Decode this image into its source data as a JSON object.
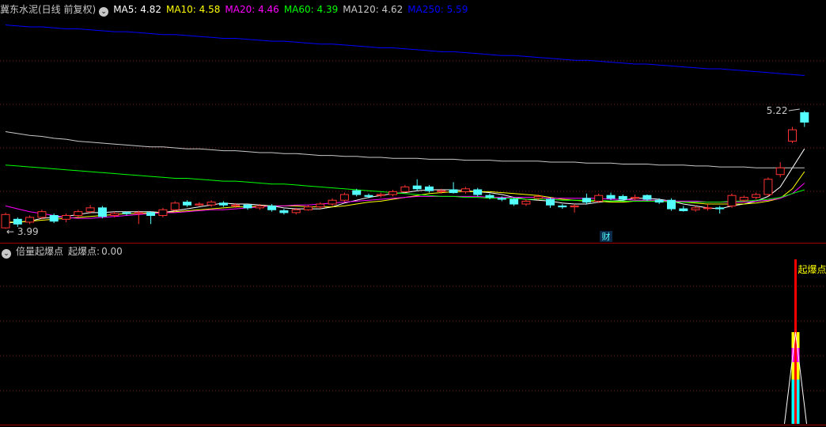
{
  "top_legend": {
    "title": "冀东水泥(日线 前复权)",
    "items": [
      {
        "name": "MA5",
        "value": "4.82",
        "color": "#ffffff"
      },
      {
        "name": "MA10",
        "value": "4.58",
        "color": "#ffff00"
      },
      {
        "name": "MA20",
        "value": "4.46",
        "color": "#ff00ff"
      },
      {
        "name": "MA60",
        "value": "4.39",
        "color": "#00ff00"
      },
      {
        "name": "MA120",
        "value": "4.62",
        "color": "#c8c8c8"
      },
      {
        "name": "MA250",
        "value": "5.59",
        "color": "#0000ff"
      }
    ]
  },
  "bottom_legend": {
    "title": "倍量起爆点",
    "item_label": "起爆点",
    "item_value": "0.00"
  },
  "chart_data": [
    {
      "type": "candlestick",
      "title": "冀东水泥(日线 前复权)",
      "ylim": [
        3.85,
        6.2
      ],
      "annotations": {
        "high_label": "5.22",
        "low_label": "3.99",
        "event_marker": "财"
      },
      "candles": [
        [
          3.99,
          4.13,
          4.15,
          3.98
        ],
        [
          4.08,
          4.03,
          4.1,
          4.0
        ],
        [
          4.05,
          4.1,
          4.12,
          4.03
        ],
        [
          4.1,
          4.16,
          4.18,
          4.08
        ],
        [
          4.12,
          4.06,
          4.14,
          4.04
        ],
        [
          4.08,
          4.12,
          4.14,
          4.05
        ],
        [
          4.12,
          4.16,
          4.18,
          4.1
        ],
        [
          4.16,
          4.2,
          4.23,
          4.14
        ],
        [
          4.2,
          4.11,
          4.22,
          4.09
        ],
        [
          4.12,
          4.14,
          4.16,
          4.1
        ],
        [
          4.15,
          4.14,
          4.16,
          4.12
        ],
        [
          4.14,
          4.15,
          4.17,
          4.03
        ],
        [
          4.15,
          4.12,
          4.16,
          4.03
        ],
        [
          4.12,
          4.18,
          4.2,
          4.1
        ],
        [
          4.18,
          4.25,
          4.27,
          4.16
        ],
        [
          4.26,
          4.23,
          4.28,
          4.21
        ],
        [
          4.23,
          4.24,
          4.26,
          4.22
        ],
        [
          4.23,
          4.26,
          4.28,
          4.21
        ],
        [
          4.25,
          4.23,
          4.27,
          4.21
        ],
        [
          4.22,
          4.23,
          4.25,
          4.2
        ],
        [
          4.23,
          4.2,
          4.24,
          4.18
        ],
        [
          4.2,
          4.22,
          4.24,
          4.18
        ],
        [
          4.22,
          4.18,
          4.24,
          4.16
        ],
        [
          4.17,
          4.15,
          4.19,
          4.13
        ],
        [
          4.15,
          4.18,
          4.2,
          4.13
        ],
        [
          4.18,
          4.21,
          4.23,
          4.17
        ],
        [
          4.21,
          4.24,
          4.26,
          4.19
        ],
        [
          4.24,
          4.28,
          4.3,
          4.22
        ],
        [
          4.28,
          4.34,
          4.36,
          4.26
        ],
        [
          4.38,
          4.34,
          4.4,
          4.32
        ],
        [
          4.33,
          4.32,
          4.35,
          4.3
        ],
        [
          4.33,
          4.34,
          4.36,
          4.31
        ],
        [
          4.34,
          4.37,
          4.39,
          4.32
        ],
        [
          4.37,
          4.42,
          4.44,
          4.36
        ],
        [
          4.43,
          4.4,
          4.5,
          4.38
        ],
        [
          4.42,
          4.38,
          4.44,
          4.36
        ],
        [
          4.37,
          4.38,
          4.4,
          4.35
        ],
        [
          4.39,
          4.36,
          4.47,
          4.35
        ],
        [
          4.37,
          4.4,
          4.42,
          4.35
        ],
        [
          4.39,
          4.34,
          4.41,
          4.32
        ],
        [
          4.33,
          4.31,
          4.35,
          4.29
        ],
        [
          4.3,
          4.29,
          4.32,
          4.27
        ],
        [
          4.29,
          4.24,
          4.31,
          4.22
        ],
        [
          4.24,
          4.27,
          4.29,
          4.22
        ],
        [
          4.3,
          4.32,
          4.34,
          4.28
        ],
        [
          4.29,
          4.23,
          4.31,
          4.2
        ],
        [
          4.22,
          4.21,
          4.24,
          4.19
        ],
        [
          4.21,
          4.22,
          4.24,
          4.15
        ],
        [
          4.3,
          4.26,
          4.35,
          4.24
        ],
        [
          4.27,
          4.33,
          4.35,
          4.25
        ],
        [
          4.33,
          4.3,
          4.36,
          4.28
        ],
        [
          4.32,
          4.29,
          4.34,
          4.27
        ],
        [
          4.3,
          4.31,
          4.34,
          4.28
        ],
        [
          4.33,
          4.29,
          4.34,
          4.27
        ],
        [
          4.28,
          4.26,
          4.3,
          4.24
        ],
        [
          4.28,
          4.19,
          4.3,
          4.17
        ],
        [
          4.19,
          4.17,
          4.22,
          4.16
        ],
        [
          4.18,
          4.2,
          4.22,
          4.16
        ],
        [
          4.2,
          4.2,
          4.24,
          4.17
        ],
        [
          4.2,
          4.19,
          4.22,
          4.14
        ],
        [
          4.22,
          4.33,
          4.35,
          4.2
        ],
        [
          4.28,
          4.31,
          4.33,
          4.26
        ],
        [
          4.31,
          4.34,
          4.36,
          4.29
        ],
        [
          4.34,
          4.5,
          4.52,
          4.32
        ],
        [
          4.55,
          4.62,
          4.68,
          4.52
        ],
        [
          4.9,
          5.02,
          5.05,
          4.88
        ],
        [
          5.2,
          5.1,
          5.22,
          5.05
        ]
      ],
      "moving_averages": [
        {
          "name": "MA5",
          "values": [
            4.04,
            4.05,
            4.06,
            4.09,
            4.1,
            4.11,
            4.13,
            4.15,
            4.15,
            4.16,
            4.16,
            4.16,
            4.16,
            4.15,
            4.17,
            4.19,
            4.21,
            4.23,
            4.25,
            4.24,
            4.24,
            4.23,
            4.22,
            4.2,
            4.19,
            4.19,
            4.19,
            4.21,
            4.25,
            4.28,
            4.31,
            4.33,
            4.35,
            4.36,
            4.38,
            4.39,
            4.39,
            4.39,
            4.38,
            4.37,
            4.36,
            4.34,
            4.31,
            4.29,
            4.28,
            4.27,
            4.25,
            4.24,
            4.24,
            4.26,
            4.27,
            4.28,
            4.3,
            4.3,
            4.29,
            4.27,
            4.24,
            4.22,
            4.2,
            4.19,
            4.22,
            4.24,
            4.27,
            4.32,
            4.42,
            4.62,
            4.82
          ]
        },
        {
          "name": "MA10",
          "values": [
            4.05,
            4.05,
            4.06,
            4.07,
            4.08,
            4.09,
            4.1,
            4.11,
            4.12,
            4.13,
            4.14,
            4.14,
            4.15,
            4.15,
            4.16,
            4.17,
            4.18,
            4.19,
            4.2,
            4.21,
            4.21,
            4.22,
            4.22,
            4.22,
            4.22,
            4.21,
            4.21,
            4.21,
            4.22,
            4.24,
            4.26,
            4.27,
            4.29,
            4.31,
            4.33,
            4.35,
            4.36,
            4.37,
            4.37,
            4.37,
            4.37,
            4.36,
            4.35,
            4.34,
            4.33,
            4.31,
            4.29,
            4.28,
            4.27,
            4.27,
            4.26,
            4.26,
            4.27,
            4.27,
            4.27,
            4.27,
            4.26,
            4.25,
            4.24,
            4.24,
            4.24,
            4.24,
            4.25,
            4.27,
            4.3,
            4.4,
            4.58
          ]
        },
        {
          "name": "MA20",
          "values": [
            4.22,
            4.19,
            4.16,
            4.14,
            4.12,
            4.1,
            4.09,
            4.09,
            4.1,
            4.11,
            4.12,
            4.13,
            4.14,
            4.15,
            4.15,
            4.16,
            4.17,
            4.18,
            4.18,
            4.19,
            4.2,
            4.21,
            4.22,
            4.22,
            4.23,
            4.23,
            4.24,
            4.25,
            4.26,
            4.27,
            4.28,
            4.29,
            4.3,
            4.31,
            4.32,
            4.32,
            4.32,
            4.32,
            4.32,
            4.32,
            4.31,
            4.31,
            4.31,
            4.31,
            4.31,
            4.3,
            4.3,
            4.3,
            4.3,
            4.3,
            4.29,
            4.29,
            4.28,
            4.28,
            4.28,
            4.27,
            4.27,
            4.27,
            4.26,
            4.26,
            4.26,
            4.26,
            4.27,
            4.28,
            4.3,
            4.35,
            4.46
          ]
        },
        {
          "name": "MA60",
          "values": [
            4.65,
            4.64,
            4.63,
            4.62,
            4.61,
            4.6,
            4.59,
            4.58,
            4.57,
            4.56,
            4.55,
            4.54,
            4.53,
            4.52,
            4.51,
            4.51,
            4.5,
            4.49,
            4.48,
            4.48,
            4.47,
            4.46,
            4.45,
            4.45,
            4.44,
            4.43,
            4.42,
            4.41,
            4.4,
            4.39,
            4.38,
            4.37,
            4.36,
            4.35,
            4.34,
            4.33,
            4.32,
            4.32,
            4.31,
            4.31,
            4.3,
            4.3,
            4.3,
            4.29,
            4.29,
            4.29,
            4.28,
            4.28,
            4.28,
            4.28,
            4.27,
            4.27,
            4.27,
            4.27,
            4.27,
            4.26,
            4.26,
            4.26,
            4.26,
            4.26,
            4.27,
            4.27,
            4.28,
            4.29,
            4.31,
            4.35,
            4.39
          ]
        },
        {
          "name": "MA120",
          "values": [
            5.0,
            4.98,
            4.96,
            4.95,
            4.93,
            4.92,
            4.9,
            4.89,
            4.88,
            4.87,
            4.86,
            4.85,
            4.84,
            4.84,
            4.83,
            4.82,
            4.82,
            4.81,
            4.8,
            4.8,
            4.79,
            4.78,
            4.78,
            4.77,
            4.77,
            4.76,
            4.75,
            4.75,
            4.74,
            4.74,
            4.73,
            4.73,
            4.72,
            4.72,
            4.72,
            4.71,
            4.71,
            4.71,
            4.7,
            4.7,
            4.7,
            4.69,
            4.69,
            4.69,
            4.69,
            4.68,
            4.68,
            4.68,
            4.67,
            4.67,
            4.67,
            4.66,
            4.66,
            4.66,
            4.65,
            4.65,
            4.65,
            4.64,
            4.64,
            4.63,
            4.63,
            4.63,
            4.62,
            4.62,
            4.62,
            4.62,
            4.62
          ]
        },
        {
          "name": "MA250",
          "values": [
            6.12,
            6.11,
            6.1,
            6.1,
            6.09,
            6.08,
            6.08,
            6.07,
            6.06,
            6.05,
            6.05,
            6.04,
            6.03,
            6.02,
            6.02,
            6.01,
            6.0,
            5.99,
            5.98,
            5.98,
            5.97,
            5.96,
            5.95,
            5.95,
            5.94,
            5.93,
            5.92,
            5.92,
            5.91,
            5.9,
            5.89,
            5.88,
            5.88,
            5.87,
            5.86,
            5.85,
            5.84,
            5.84,
            5.83,
            5.82,
            5.81,
            5.8,
            5.8,
            5.79,
            5.78,
            5.77,
            5.76,
            5.75,
            5.75,
            5.74,
            5.73,
            5.72,
            5.71,
            5.71,
            5.7,
            5.69,
            5.68,
            5.67,
            5.66,
            5.66,
            5.65,
            5.64,
            5.63,
            5.62,
            5.61,
            5.6,
            5.59
          ]
        }
      ]
    },
    {
      "type": "bar",
      "title": "倍量起爆点",
      "series_name": "起爆点",
      "signal_index": 65,
      "signal_label": "起爆点",
      "value": "0.00",
      "stack_colors": [
        "#ff0000",
        "#00ffff",
        "#ffff00",
        "#ff00ff",
        "#ffff00"
      ]
    }
  ],
  "colors": {
    "up": "#ff3232",
    "down": "#54ffff",
    "grid": "#801818",
    "divider": "#a00000",
    "marker": "#54ffff"
  }
}
